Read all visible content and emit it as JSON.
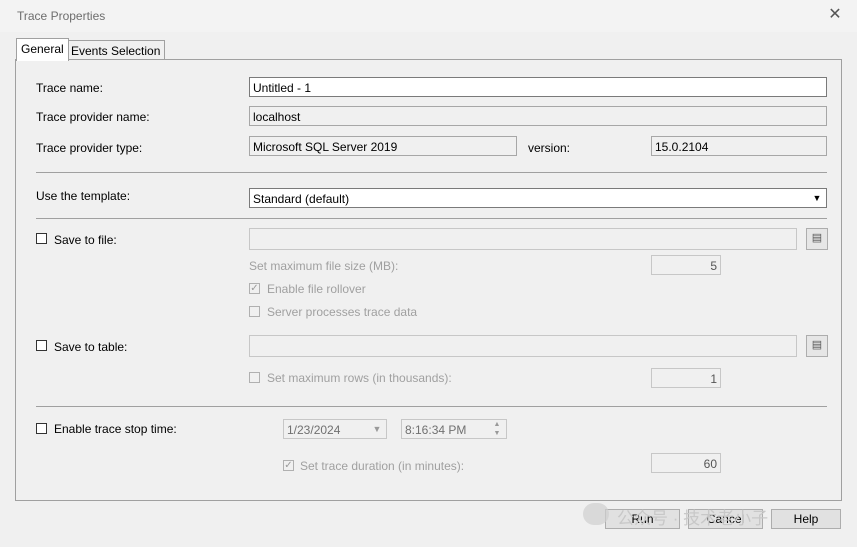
{
  "window": {
    "title": "Trace Properties"
  },
  "tabs": [
    {
      "label": "General"
    },
    {
      "label": "Events Selection"
    }
  ],
  "general": {
    "trace_name_label": "Trace name:",
    "trace_name_value": "Untitled - 1",
    "provider_name_label": "Trace provider name:",
    "provider_name_value": "localhost",
    "provider_type_label": "Trace provider type:",
    "provider_type_value": "Microsoft SQL Server 2019",
    "version_label": "version:",
    "version_value": "15.0.2104",
    "template_label": "Use the template:",
    "template_value": "Standard (default)",
    "save_to_file_label": "Save to file:",
    "max_file_size_label": "Set maximum file size (MB):",
    "max_file_size_value": "5",
    "enable_rollover_label": "Enable file rollover",
    "server_processes_label": "Server processes trace data",
    "save_to_table_label": "Save to table:",
    "max_rows_label": "Set maximum rows (in thousands):",
    "max_rows_value": "1",
    "stop_time_label": "Enable trace stop time:",
    "stop_date_value": "1/23/2024",
    "stop_time_value": "8:16:34 PM",
    "trace_duration_label": "Set trace duration (in minutes):",
    "trace_duration_value": "60"
  },
  "buttons": {
    "run": "Run",
    "cancel": "Cancel",
    "help": "Help"
  },
  "watermark": {
    "text": "公众号 · 技术老小子"
  }
}
